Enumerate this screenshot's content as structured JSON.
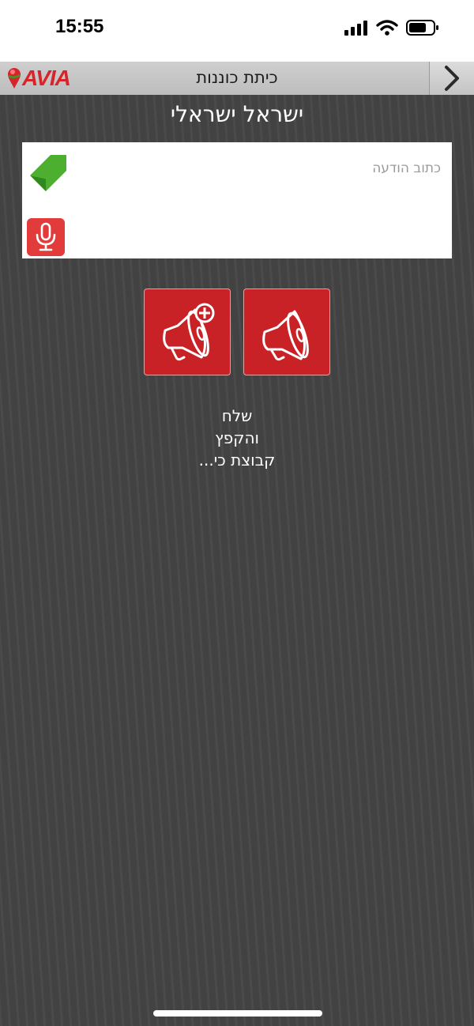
{
  "status_bar": {
    "time": "15:55",
    "icons": [
      "cellular-signal-icon",
      "wifi-icon",
      "battery-icon"
    ]
  },
  "nav_bar": {
    "logo_text": "AVIA",
    "title": "כיתת כוננות",
    "back_icon": "chevron-right-icon"
  },
  "user": {
    "name": "ישראל ישראלי"
  },
  "message": {
    "placeholder": "כתוב הודעה",
    "value": "",
    "send_icon": "send-arrow-icon",
    "mic_icon": "microphone-icon"
  },
  "actions": {
    "alarm_add_icon": "megaphone-plus-icon",
    "alarm_send_icon": "megaphone-icon"
  },
  "caption": {
    "line1": "שלח",
    "line2": "והקפץ",
    "line3": "קבוצת כי..."
  },
  "colors": {
    "accent_red": "#c82126",
    "mic_red": "#e23b3b",
    "send_green": "#4caf2f",
    "background": "#424242"
  }
}
